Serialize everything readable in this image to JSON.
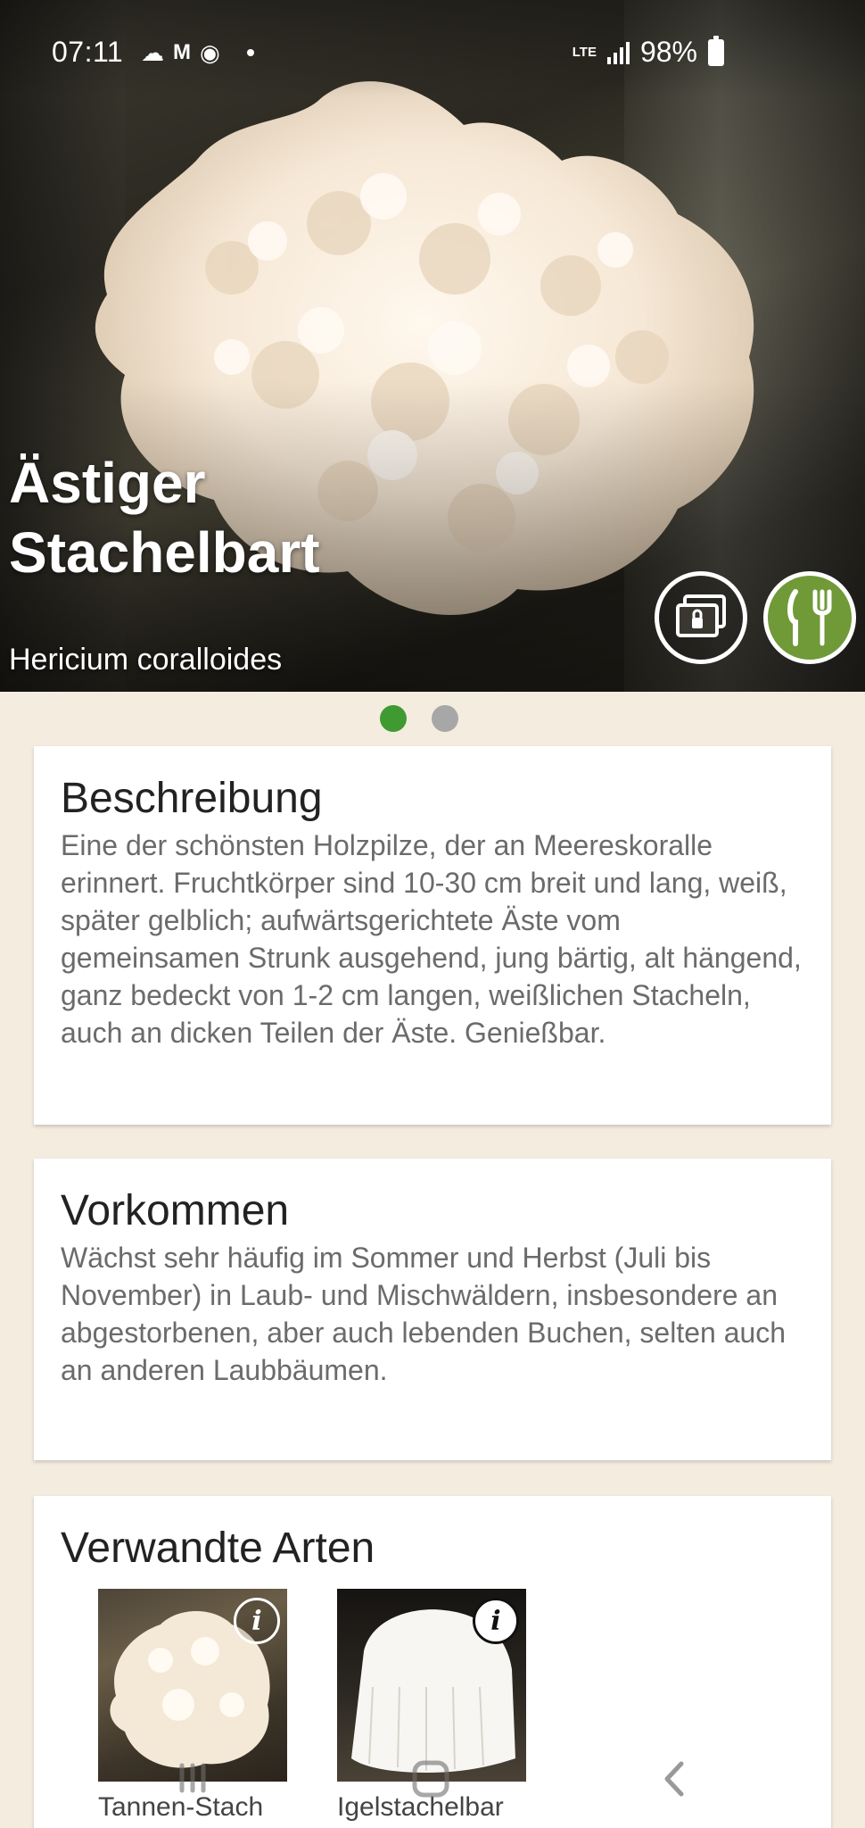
{
  "status_bar": {
    "time": "07:11",
    "notification_icons": [
      "cloud-icon",
      "gmail-icon",
      "chrome-icon"
    ],
    "network": "LTE",
    "battery": "98%"
  },
  "hero": {
    "title": "Ästiger Stachelbart",
    "latin_name": "Hericium coralloides",
    "gallery_icon": "gallery-icon",
    "edible_icon": "fork-knife-icon",
    "edible_color": "#6f9a37",
    "pager": {
      "pages": 2,
      "active": 1,
      "active_color": "#3f9a32"
    }
  },
  "description": {
    "heading": "Beschreibung",
    "text": "Eine der schönsten Holzpilze, der an Meereskoralle erinnert. Fruchtkörper sind 10-30 cm breit und lang, weiß, später gelblich; aufwärtsgerichtete Äste vom gemeinsamen Strunk ausgehend, jung bärtig, alt hängend, ganz bedeckt von 1-2 cm langen, weißlichen Stacheln, auch an dicken Teilen der Äste. Genießbar."
  },
  "occurrence": {
    "heading": "Vorkommen",
    "text": "Wächst sehr häufig im Sommer und Herbst (Juli bis November) in Laub- und Mischwäldern, insbesondere an abgestorbenen, aber auch lebenden Buchen, selten auch an anderen Laubbäumen."
  },
  "related": {
    "heading": "Verwandte Arten",
    "items": [
      {
        "label": "Tannen-Stach",
        "icon": "info-icon"
      },
      {
        "label": "Igelstachelbar",
        "icon": "info-icon"
      }
    ]
  },
  "navbar": {
    "icons": [
      "recents-icon",
      "home-icon",
      "back-icon"
    ]
  }
}
